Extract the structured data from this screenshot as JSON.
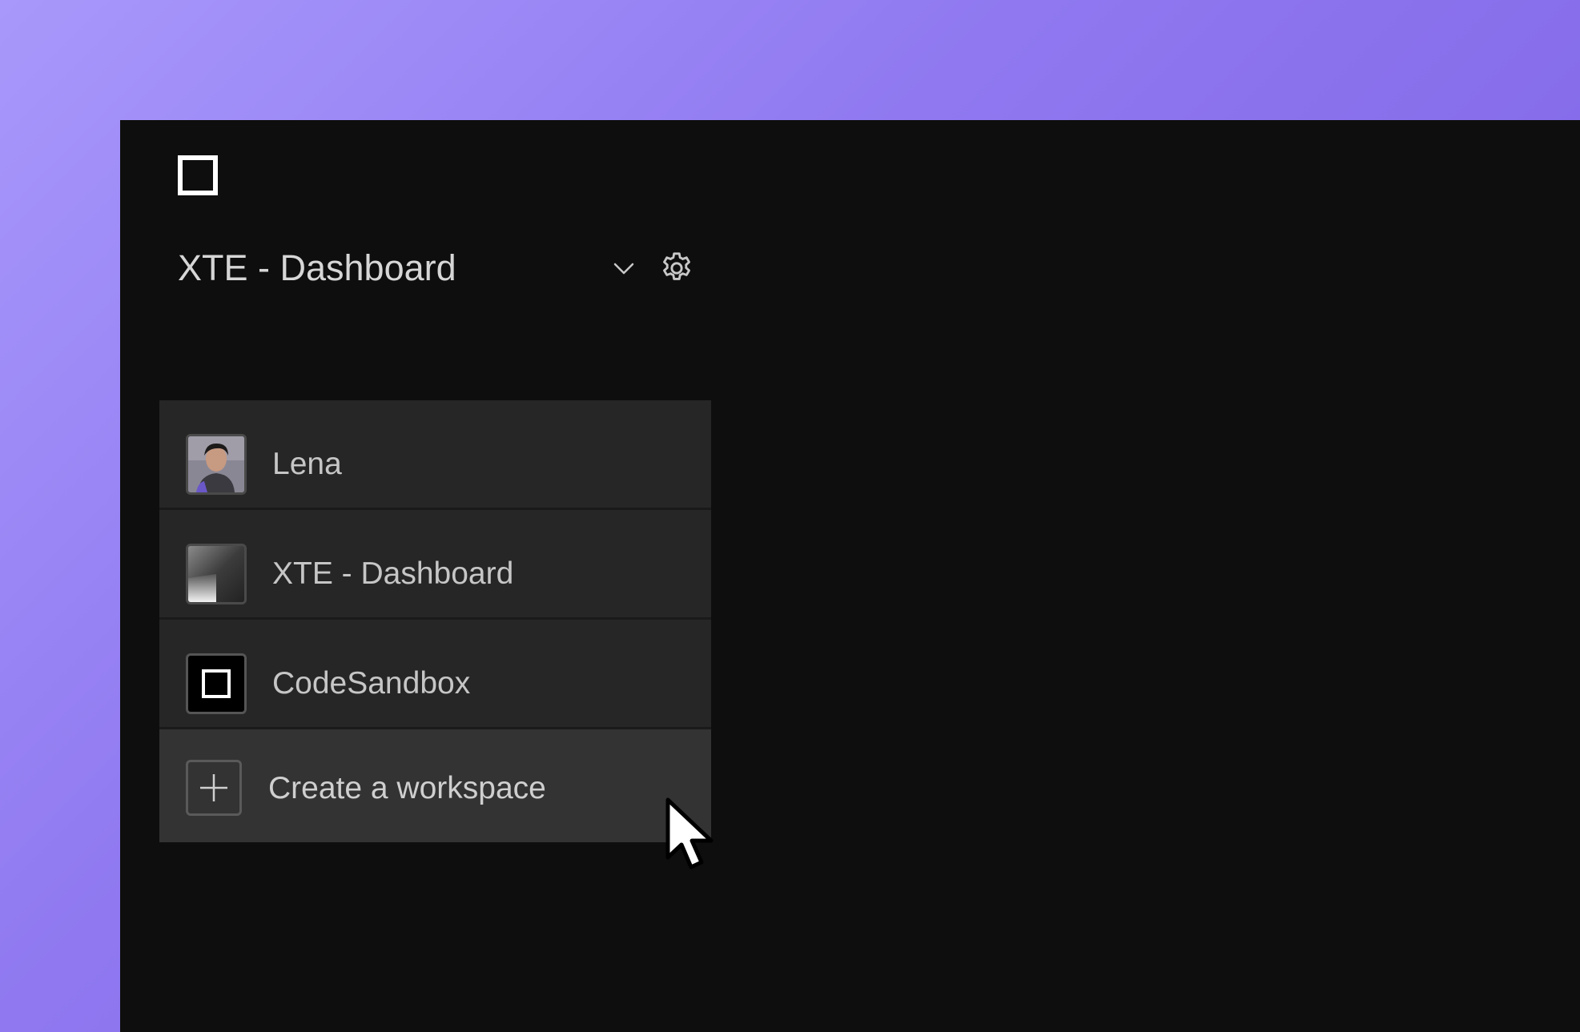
{
  "workspace": {
    "current": "XTE - Dashboard"
  },
  "menu": {
    "items": [
      {
        "label": "Lena",
        "icon": "user-avatar-photo"
      },
      {
        "label": "XTE - Dashboard",
        "icon": "gradient-workspace-avatar"
      },
      {
        "label": "CodeSandbox",
        "icon": "codesandbox-logo"
      },
      {
        "label": "Create a workspace",
        "icon": "plus-icon"
      }
    ]
  },
  "colors": {
    "background_gradient_start": "#a898fb",
    "background_gradient_end": "#7a5ce0",
    "window": "#0e0e0e",
    "menu": "#262626",
    "menu_hover": "#333333"
  }
}
